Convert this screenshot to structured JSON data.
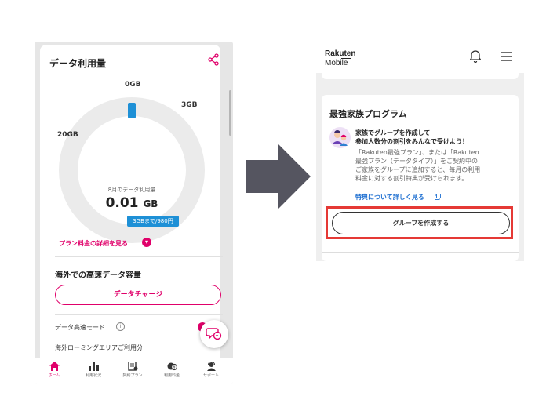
{
  "left_screen": {
    "title": "データ利用量",
    "gauge": {
      "label_top": "0GB",
      "label_right": "3GB",
      "label_left": "20GB",
      "center_subtitle": "8月のデータ利用量",
      "center_value": "0.01",
      "center_unit": "GB",
      "badge": "3GBまで/980円",
      "used_fraction": 0.01
    },
    "plan_link": "プラン料金の詳細を見る",
    "overseas_title": "海外での高速データ容量",
    "charge_button": "データチャージ",
    "speed_mode_label": "データ高速モード",
    "roaming_label": "海外ローミングエリアご利用分",
    "nav": [
      {
        "label": "ホーム",
        "icon": "home-icon",
        "active": true
      },
      {
        "label": "利用状況",
        "icon": "bar-chart-icon",
        "active": false
      },
      {
        "label": "契約プラン",
        "icon": "contract-icon",
        "active": false
      },
      {
        "label": "利用料金",
        "icon": "yen-icon",
        "active": false
      },
      {
        "label": "サポート",
        "icon": "support-icon",
        "active": false
      }
    ]
  },
  "right_screen": {
    "logo_top": "Rakuten",
    "logo_bottom": "Mobile",
    "card_title": "最強家族プログラム",
    "headline_line1": "家族でグループを作成して",
    "headline_line2": "参加人数分の割引をみんなで受けよう！",
    "body_line1": "「Rakuten最強プラン」、または「Rakuten",
    "body_line2": "最強プラン（データタイプ）」をご契約中の",
    "body_line3": "ご家族をグループに追加すると、毎月の利用",
    "body_line4": "料金に対する割引特典が受けられます。",
    "detail_link": "特典について詳しく見る",
    "group_button": "グループを作成する"
  },
  "colors": {
    "accent_pink": "#e0006a",
    "badge_blue": "#1e90d6",
    "link_blue": "#1e6fd1",
    "highlight_red": "#e53935",
    "arrow_gray": "#555560"
  }
}
